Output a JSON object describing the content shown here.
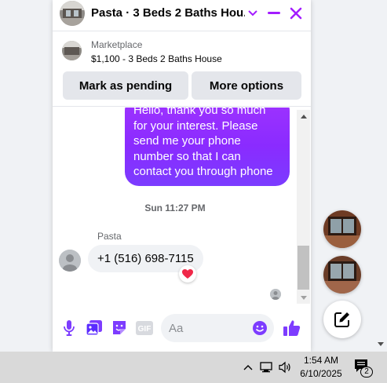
{
  "header": {
    "title": "Pasta · 3 Beds 2 Baths Hou...",
    "accent_color": "#a31cff"
  },
  "marketplace": {
    "label": "Marketplace",
    "listing": "$1,100 - 3 Beds 2 Baths House",
    "pending_button": "Mark as pending",
    "more_button": "More options"
  },
  "messages": {
    "outgoing_lines": [
      "Hello, thank you so much",
      "for your interest. Please",
      "send me your phone",
      "number so that I can",
      "contact you through phone"
    ],
    "timestamp": "Sun 11:27 PM",
    "sender_name": "Pasta",
    "incoming_text": "+1 (516) 698-7115",
    "reaction": "❤️"
  },
  "composer": {
    "placeholder": "Aa",
    "gif_label": "GIF"
  },
  "taskbar": {
    "time": "1:54 AM",
    "date": "6/10/2025",
    "notification_count": "2"
  }
}
